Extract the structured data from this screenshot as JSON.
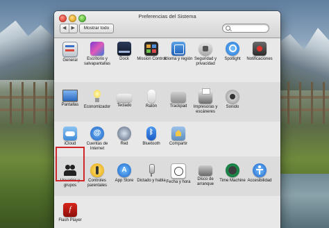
{
  "window": {
    "title": "Preferencias del Sistema",
    "nav_back": "◀",
    "nav_forward": "▶",
    "show_all": "Mostrar todo",
    "search": {
      "value": "",
      "placeholder": ""
    }
  },
  "rows": [
    {
      "panes": [
        {
          "label": "General",
          "icon": "general-icon"
        },
        {
          "label": "Escritorio y salvapantallas",
          "icon": "desktop-icon"
        },
        {
          "label": "Dock",
          "icon": "dock-icon"
        },
        {
          "label": "Mission Control",
          "icon": "mission-control-icon"
        },
        {
          "label": "Idioma y región",
          "icon": "language-icon"
        },
        {
          "label": "Seguridad y privacidad",
          "icon": "security-icon"
        },
        {
          "label": "Spotlight",
          "icon": "spotlight-icon"
        },
        {
          "label": "Notificaciones",
          "icon": "notifications-icon"
        }
      ]
    },
    {
      "panes": [
        {
          "label": "Pantallas",
          "icon": "display-icon"
        },
        {
          "label": "Economizador",
          "icon": "energy-icon"
        },
        {
          "label": "Teclado",
          "icon": "keyboard-icon"
        },
        {
          "label": "Ratón",
          "icon": "mouse-icon"
        },
        {
          "label": "Trackpad",
          "icon": "trackpad-icon"
        },
        {
          "label": "Impresoras y escáneres",
          "icon": "printer-icon"
        },
        {
          "label": "Sonido",
          "icon": "sound-icon"
        }
      ]
    },
    {
      "panes": [
        {
          "label": "iCloud",
          "icon": "icloud-icon"
        },
        {
          "label": "Cuentas de Internet",
          "icon": "internet-accounts-icon"
        },
        {
          "label": "Red",
          "icon": "network-icon"
        },
        {
          "label": "Bluetooth",
          "icon": "bluetooth-icon"
        },
        {
          "label": "Compartir",
          "icon": "sharing-icon"
        }
      ]
    },
    {
      "panes": [
        {
          "label": "Usuarios y grupos",
          "icon": "users-icon"
        },
        {
          "label": "Controles parentales",
          "icon": "parental-controls-icon"
        },
        {
          "label": "App Store",
          "icon": "app-store-icon"
        },
        {
          "label": "Dictado y habla",
          "icon": "dictation-icon"
        },
        {
          "label": "Fecha y hora",
          "icon": "date-time-icon"
        },
        {
          "label": "Disco de arranque",
          "icon": "startup-disk-icon"
        },
        {
          "label": "Time Machine",
          "icon": "time-machine-icon"
        },
        {
          "label": "Accesibilidad",
          "icon": "accessibility-icon"
        }
      ]
    },
    {
      "panes": [
        {
          "label": "Flash Player",
          "icon": "flash-player-icon"
        }
      ]
    }
  ],
  "selected_pane": "Usuarios y grupos"
}
